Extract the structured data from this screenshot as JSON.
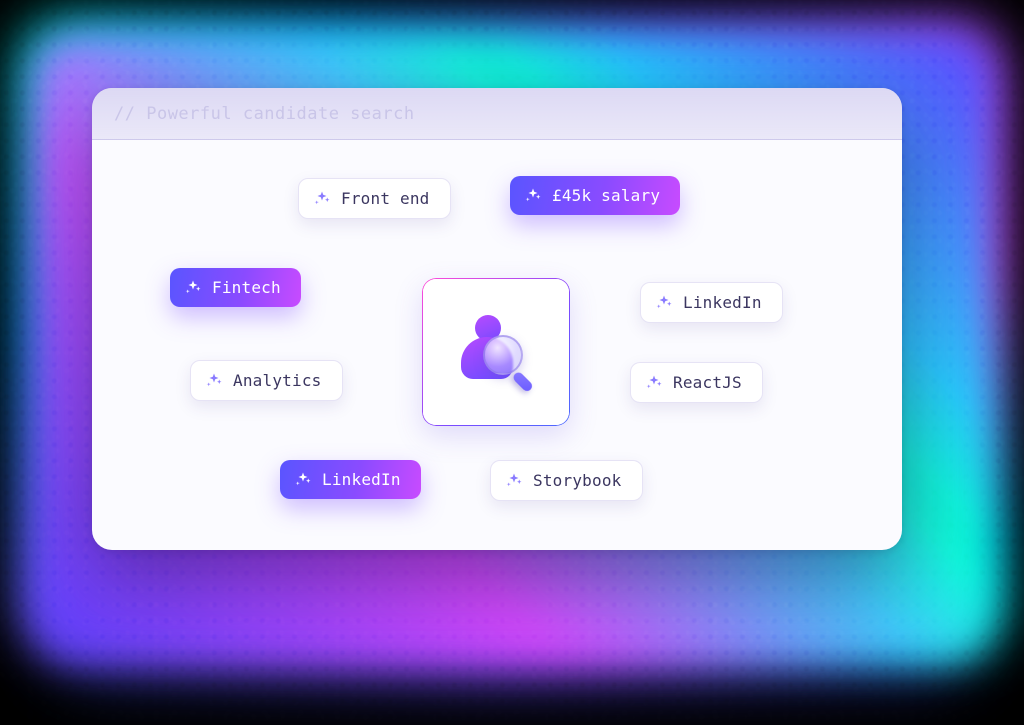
{
  "header": {
    "title_prefix": "// ",
    "title": "Powerful candidate search"
  },
  "center": {
    "semantic": "person-search"
  },
  "chips": {
    "front_end": {
      "label": "Front end",
      "filled": false
    },
    "salary": {
      "label": "£45k salary",
      "filled": true
    },
    "fintech": {
      "label": "Fintech",
      "filled": true
    },
    "linkedin_1": {
      "label": "LinkedIn",
      "filled": false
    },
    "analytics": {
      "label": "Analytics",
      "filled": false
    },
    "reactjs": {
      "label": "ReactJS",
      "filled": false
    },
    "linkedin_2": {
      "label": "LinkedIn",
      "filled": true
    },
    "storybook": {
      "label": "Storybook",
      "filled": false
    }
  },
  "colors": {
    "gradient_start": "#5a55ff",
    "gradient_mid": "#8a4bff",
    "gradient_end": "#c84bff",
    "chip_border": "#e6e3f5",
    "text_primary": "#3b3660",
    "card_bg": "#fbfbff"
  }
}
